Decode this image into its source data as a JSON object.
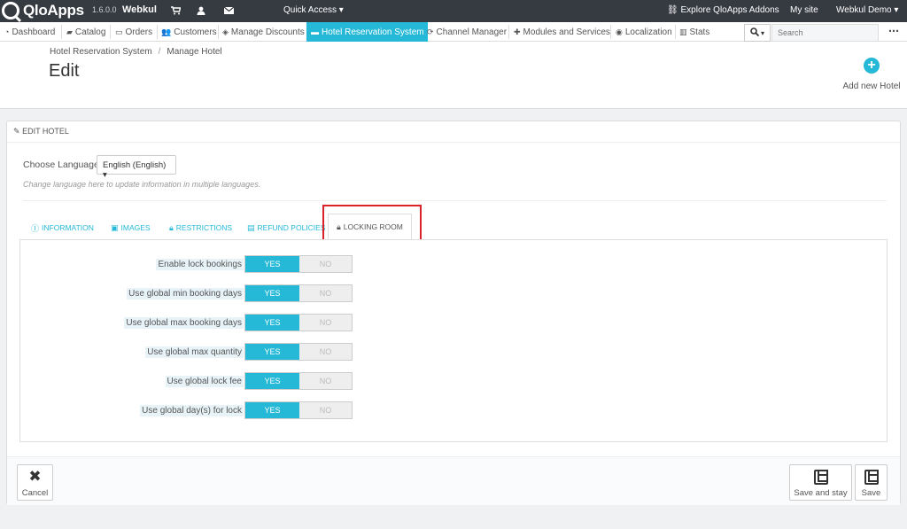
{
  "topbar": {
    "logo_text": "QloApps",
    "version": "1.6.0.0",
    "shop_name": "Webkul",
    "quick_access": "Quick Access ▾",
    "explore": "Explore QloApps Addons",
    "my_site": "My site",
    "user": "Webkul Demo ▾"
  },
  "nav": {
    "items": [
      {
        "label": "Dashboard",
        "icon": "dashboard-icon"
      },
      {
        "label": "Catalog",
        "icon": "book-icon"
      },
      {
        "label": "Orders",
        "icon": "credit-card-icon"
      },
      {
        "label": "Customers",
        "icon": "users-icon"
      },
      {
        "label": "Manage Discounts",
        "icon": "tag-icon"
      },
      {
        "label": "Hotel Reservation System",
        "icon": "bed-icon"
      },
      {
        "label": "Channel Manager",
        "icon": "refresh-icon"
      },
      {
        "label": "Modules and Services",
        "icon": "puzzle-icon"
      },
      {
        "label": "Localization",
        "icon": "globe-icon"
      },
      {
        "label": "Stats",
        "icon": "bar-chart-icon"
      }
    ],
    "active": "Hotel Reservation System",
    "search_placeholder": "Search"
  },
  "header": {
    "breadcrumb": [
      "Hotel Reservation System",
      "Manage Hotel"
    ],
    "title": "Edit",
    "add_new_label": "Add new Hotel"
  },
  "panel": {
    "heading": "EDIT HOTEL",
    "lang_label": "Choose Language",
    "lang_value": "English (English) ▾",
    "lang_help": "Change language here to update information in multiple languages.",
    "tabs": [
      {
        "label": "INFORMATION",
        "icon": "info-icon"
      },
      {
        "label": "IMAGES",
        "icon": "image-icon"
      },
      {
        "label": "RESTRICTIONS",
        "icon": "lock-icon"
      },
      {
        "label": "REFUND POLICIES",
        "icon": "file-icon"
      },
      {
        "label": "LOCKING ROOM",
        "icon": "lock-icon"
      }
    ],
    "active_tab": "LOCKING ROOM",
    "rows": [
      {
        "label": "Enable lock bookings",
        "yes": "YES",
        "no": "NO",
        "value": "YES"
      },
      {
        "label": "Use global min booking days",
        "yes": "YES",
        "no": "NO",
        "value": "YES"
      },
      {
        "label": "Use global max booking days",
        "yes": "YES",
        "no": "NO",
        "value": "YES"
      },
      {
        "label": "Use global max quantity",
        "yes": "YES",
        "no": "NO",
        "value": "YES"
      },
      {
        "label": "Use global lock fee",
        "yes": "YES",
        "no": "NO",
        "value": "YES"
      },
      {
        "label": "Use global day(s) for lock",
        "yes": "YES",
        "no": "NO",
        "value": "YES"
      }
    ]
  },
  "footer": {
    "cancel": "Cancel",
    "save_and_stay": "Save and stay",
    "save": "Save"
  },
  "colors": {
    "accent": "#25b9d7",
    "topbar": "#363a41",
    "highlight": "#d9222a"
  }
}
